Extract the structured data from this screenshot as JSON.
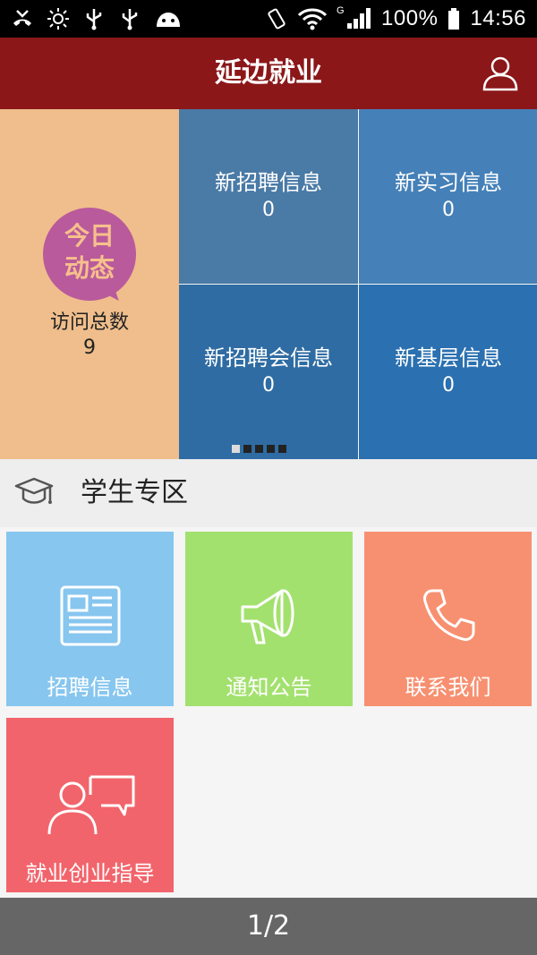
{
  "status_bar": {
    "battery": "100%",
    "time": "14:56",
    "network": "G",
    "icons": [
      "missed-call-icon",
      "brightness-icon",
      "usb-icon",
      "usb-icon",
      "android-icon",
      "vibrate-icon",
      "wifi-icon",
      "signal-icon",
      "battery-icon"
    ]
  },
  "header": {
    "title": "延边就业",
    "user_icon": "user-icon"
  },
  "dashboard": {
    "today_badge_line1": "今日",
    "today_badge_line2": "动态",
    "visits_label": "访问总数",
    "visits_value": "9",
    "stats": [
      {
        "label": "新招聘信息",
        "value": "0"
      },
      {
        "label": "新实习信息",
        "value": "0"
      },
      {
        "label": "新招聘会信息",
        "value": "0"
      },
      {
        "label": "新基层信息",
        "value": "0"
      }
    ],
    "carousel_active_index": 1,
    "carousel_count": 5
  },
  "section": {
    "title": "学生专区",
    "icon": "graduation-cap-icon"
  },
  "tiles": [
    {
      "label": "招聘信息",
      "icon": "newspaper-icon",
      "color": "#87c6ef"
    },
    {
      "label": "通知公告",
      "icon": "megaphone-icon",
      "color": "#a3e16f"
    },
    {
      "label": "联系我们",
      "icon": "phone-icon",
      "color": "#f79070"
    },
    {
      "label": "就业创业指导",
      "icon": "consult-icon",
      "color": "#f2646b"
    }
  ],
  "pager": {
    "text": "1/2"
  },
  "colors": {
    "title_bar": "#8b1719",
    "today_panel": "#efbe8c",
    "badge": "#b95a9c"
  }
}
